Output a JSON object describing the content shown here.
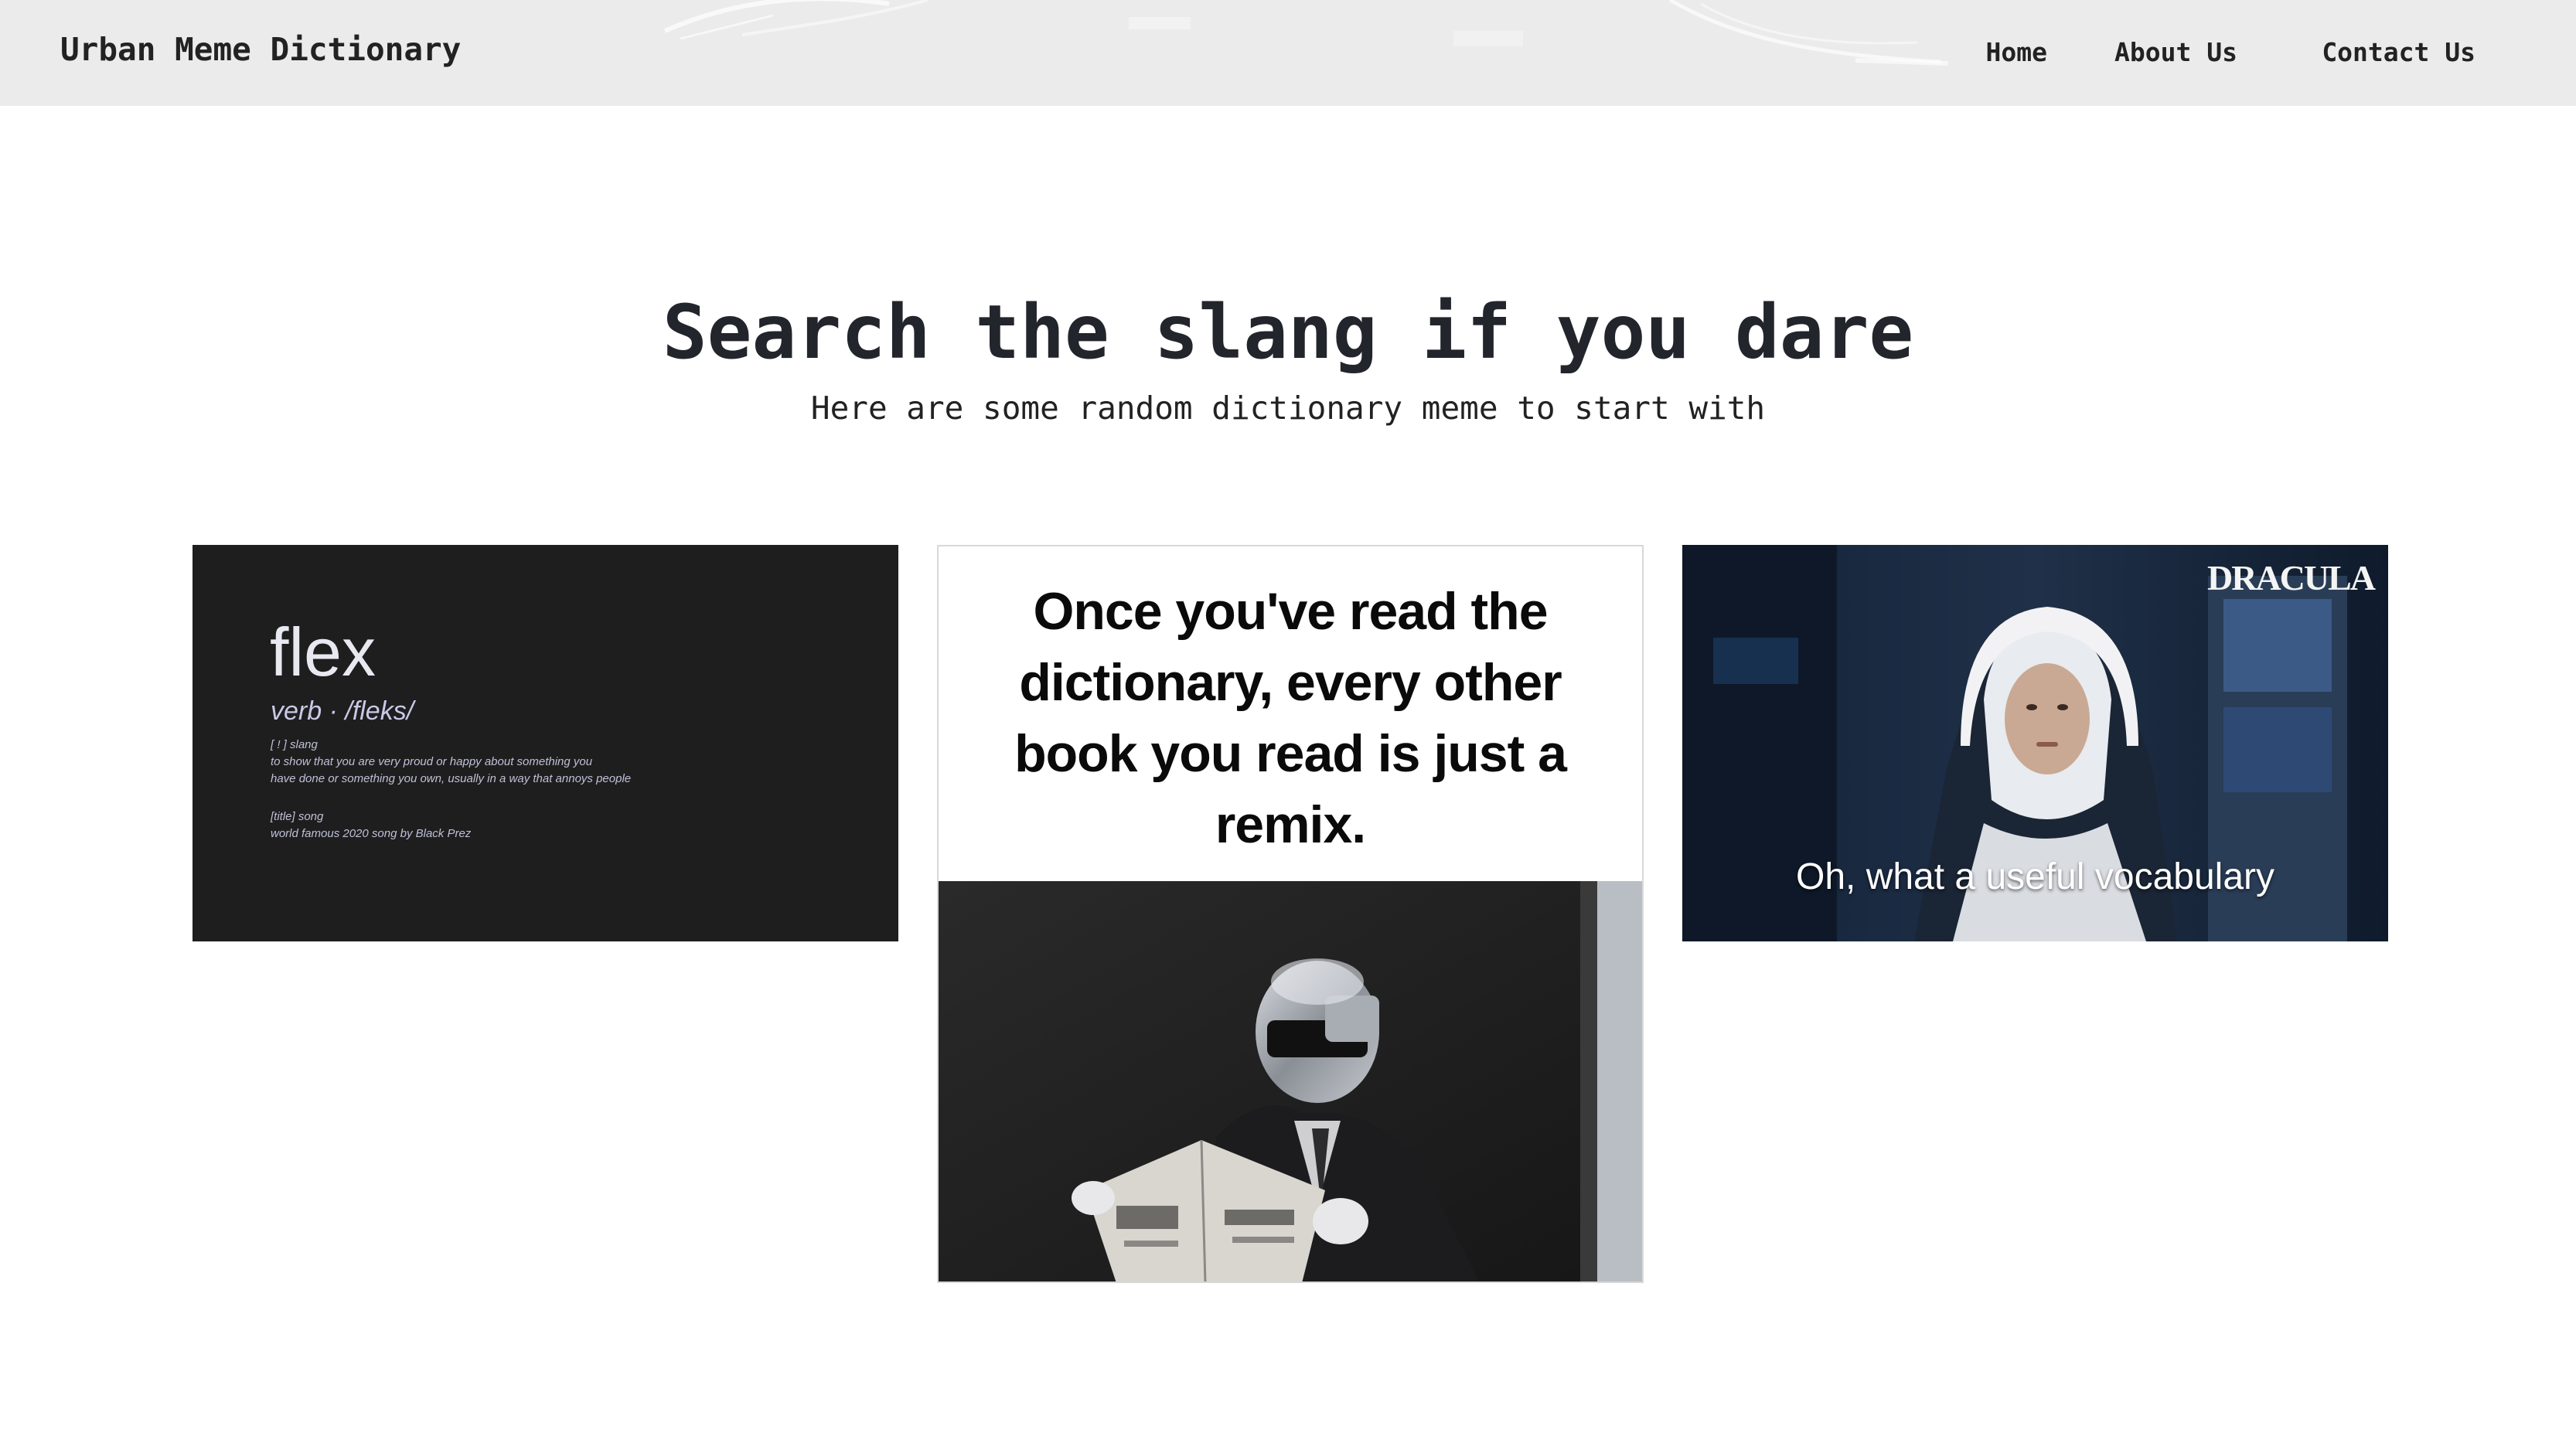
{
  "navbar": {
    "brand": "Urban Meme Dictionary",
    "links": [
      {
        "label": "Home"
      },
      {
        "label": "About Us"
      },
      {
        "label": "Contact Us"
      }
    ],
    "background": "#ebebeb"
  },
  "hero": {
    "title": "Search the slang if you dare",
    "subtitle": "Here are some random dictionary meme to start with"
  },
  "memes": [
    {
      "word": "flex",
      "pronunciation": "verb · /fleks/",
      "sense1_tag": "[ ! ] slang",
      "sense1_line1": "to show that you are very proud or happy about something you",
      "sense1_line2": "have done or something you own, usually in a way that annoys people",
      "sense2_tag": "[title] song",
      "sense2_line1": "world famous 2020 song by Black Prez",
      "background": "#1e1e1f"
    },
    {
      "quote": "Once you've read the dictionary, every other book you read is just a remix."
    },
    {
      "logo": "DRACULA",
      "caption": "Oh, what a useful vocabulary",
      "background": "#1d2c3f"
    }
  ]
}
